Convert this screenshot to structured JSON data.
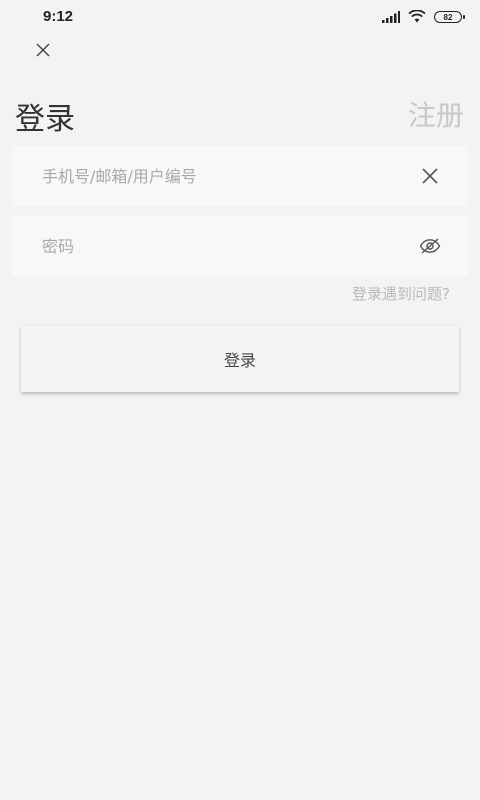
{
  "status_bar": {
    "time": "9:12",
    "battery_level": "82",
    "signal_icon": "signal-icon",
    "wifi_icon": "wifi-icon"
  },
  "header": {
    "close_icon": "close-icon",
    "title": "登录",
    "register_label": "注册"
  },
  "form": {
    "account": {
      "placeholder": "手机号/邮箱/用户编号",
      "value": "",
      "clear_icon": "clear-icon"
    },
    "password": {
      "placeholder": "密码",
      "value": "",
      "visibility_icon": "eye-off-icon"
    },
    "forgot_label": "登录遇到问题?",
    "submit_label": "登录"
  },
  "colors": {
    "background": "#f3f3f3",
    "field_background": "#f8f8f8",
    "muted_text": "#c8c8c8",
    "title_text": "#333333"
  }
}
